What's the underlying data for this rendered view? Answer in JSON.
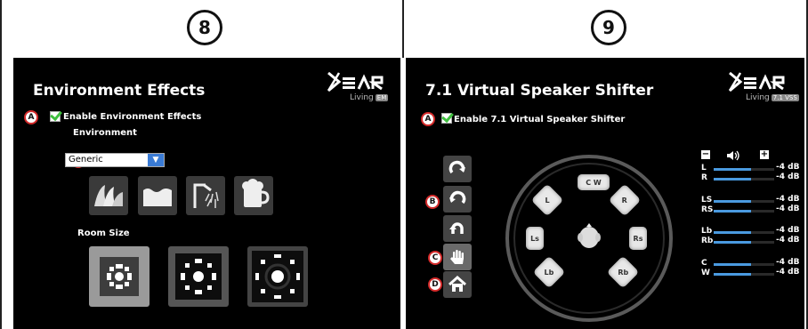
{
  "steps": {
    "left": "8",
    "right": "9"
  },
  "markers": {
    "a": "A",
    "b": "B",
    "c": "C",
    "d": "D"
  },
  "left_panel": {
    "title": "Environment Effects",
    "logo": {
      "brand": "Xear",
      "tm": "™",
      "product": "Living",
      "badge": "EM"
    },
    "enable_label": "Enable Environment Effects",
    "enabled": true,
    "environment_label": "Environment",
    "environment_value": "Generic",
    "environment_icons": [
      "theater-icon",
      "water-icon",
      "shower-icon",
      "mug-icon"
    ],
    "room_size_label": "Room Size",
    "room_sizes": [
      "small-room",
      "medium-room",
      "large-room"
    ],
    "selected_room": 0
  },
  "right_panel": {
    "title": "7.1 Virtual Speaker Shifter",
    "logo": {
      "brand": "Xear",
      "tm": "™",
      "product": "Living",
      "badge": "7.1 VSS"
    },
    "enable_label": "Enable 7.1 Virtual Speaker Shifter",
    "enabled": true,
    "side_buttons": [
      "rotate-clockwise-icon",
      "rotate-counterclockwise-icon",
      "rotate-reset-icon",
      "hand-icon",
      "home-icon"
    ],
    "speakers": [
      "L",
      "C",
      "W",
      "R",
      "Ls",
      "Rs",
      "Lb",
      "Rb"
    ],
    "volume_header": {
      "minus": "−",
      "plus": "+"
    },
    "channels": [
      {
        "name": "L",
        "db": "-4 dB",
        "level": 0.62
      },
      {
        "name": "R",
        "db": "-4 dB",
        "level": 0.62
      },
      {
        "name": "LS",
        "db": "-4 dB",
        "level": 0.62
      },
      {
        "name": "RS",
        "db": "-4 dB",
        "level": 0.62
      },
      {
        "name": "Lb",
        "db": "-4 dB",
        "level": 0.62
      },
      {
        "name": "Rb",
        "db": "-4 dB",
        "level": 0.62
      },
      {
        "name": "C",
        "db": "-4 dB",
        "level": 0.62
      },
      {
        "name": "W",
        "db": "-4 dB",
        "level": 0.62
      }
    ]
  },
  "colors": {
    "accent": "#3a7bd5",
    "check": "#3fbf3f",
    "marker": "#d42a2a",
    "meter": "#4a9ae0"
  }
}
